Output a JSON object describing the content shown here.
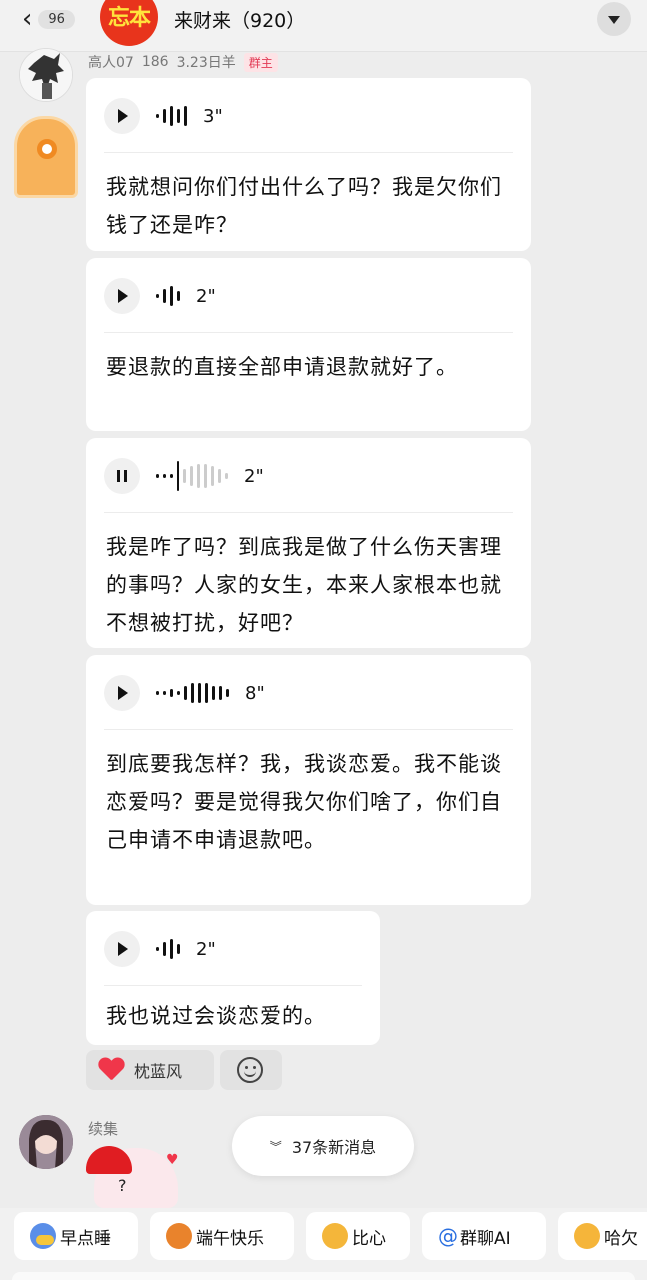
{
  "header": {
    "back_chevron": "‹",
    "unread_count": "96",
    "group_avatar_text": "忘本",
    "title": "来财来（920）"
  },
  "sender": {
    "name": "高人07",
    "level": "186",
    "date": "3.23日羊",
    "badge": "群主"
  },
  "messages": [
    {
      "state": "play",
      "duration": "3\"",
      "text": "我就想问你们付出什么了吗？我是欠你们钱了还是咋？"
    },
    {
      "state": "play",
      "duration": "2\"",
      "text": "要退款的直接全部申请退款就好了。"
    },
    {
      "state": "pause",
      "duration": "2\"",
      "text": "我是咋了吗？到底我是做了什么伤天害理的事吗？人家的女生，本来人家根本也就不想被打扰，好吧？"
    },
    {
      "state": "play",
      "duration": "8\"",
      "text": "到底要我怎样？我，我谈恋爱。我不能谈恋爱吗？要是觉得我欠你们啥了，你们自己申请不申请退款吧。"
    },
    {
      "state": "play",
      "duration": "2\"",
      "text": "我也说过会谈恋爱的。"
    }
  ],
  "reaction": {
    "name": "枕蓝风",
    "icon": "heart-icon"
  },
  "sender2": {
    "name": "续集"
  },
  "sticker": {
    "text": "?"
  },
  "new_messages": {
    "icon": "double-chevron-down-icon",
    "text": "37条新消息"
  },
  "quick_replies": [
    {
      "label": "早点睡",
      "icon": "moon-sticker-icon"
    },
    {
      "label": "端午快乐",
      "icon": "dragon-sticker-icon"
    },
    {
      "label": "比心",
      "icon": "heart-hands-sticker-icon"
    },
    {
      "label": "群聊AI",
      "prefix": "@"
    },
    {
      "label": "哈欠",
      "icon": "yawn-sticker-icon"
    }
  ]
}
